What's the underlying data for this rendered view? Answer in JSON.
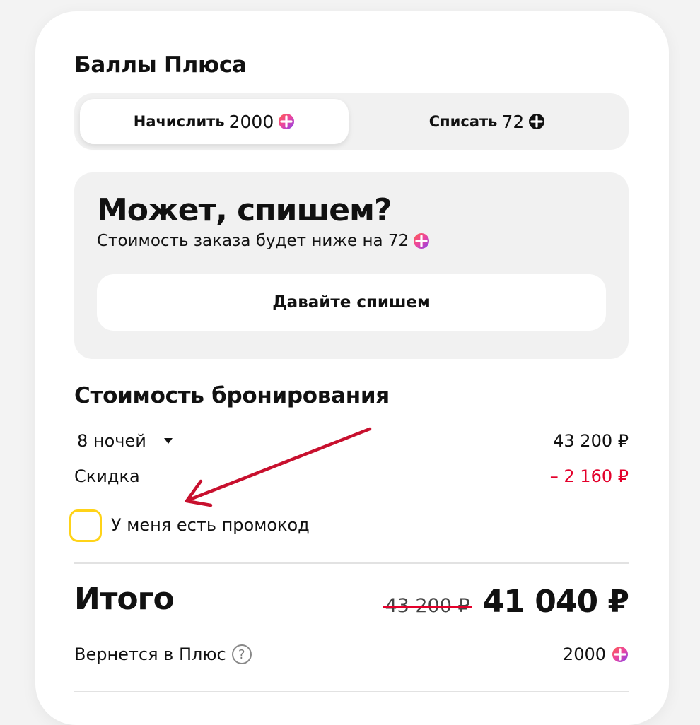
{
  "plus_points": {
    "title": "Баллы Плюса",
    "tabs": [
      {
        "label": "Начислить",
        "amount": "2000",
        "icon": "plus-points-icon",
        "active": true
      },
      {
        "label": "Списать",
        "amount": "72",
        "icon": "plus-points-icon",
        "active": false
      }
    ]
  },
  "promo": {
    "title": "Может, спишем?",
    "subtitle": "Стоимость заказа будет ниже на 72",
    "button_label": "Давайте спишем"
  },
  "booking": {
    "title": "Стоимость бронирования",
    "nights_label": "8 ночей",
    "nights_value": "43 200 ₽",
    "discount_label": "Скидка",
    "discount_value": "– 2 160 ₽",
    "promocode_label": "У меня есть промокод",
    "promocode_checked": false
  },
  "total": {
    "label": "Итого",
    "old_price": "43 200 ₽",
    "price": "41 040 ₽",
    "cashback_label": "Вернется в Плюс",
    "cashback_value": "2000",
    "help_glyph": "?"
  },
  "colors": {
    "accent_red": "#e4002b",
    "checkbox_border": "#ffd318",
    "arrow": "#c8102e"
  }
}
